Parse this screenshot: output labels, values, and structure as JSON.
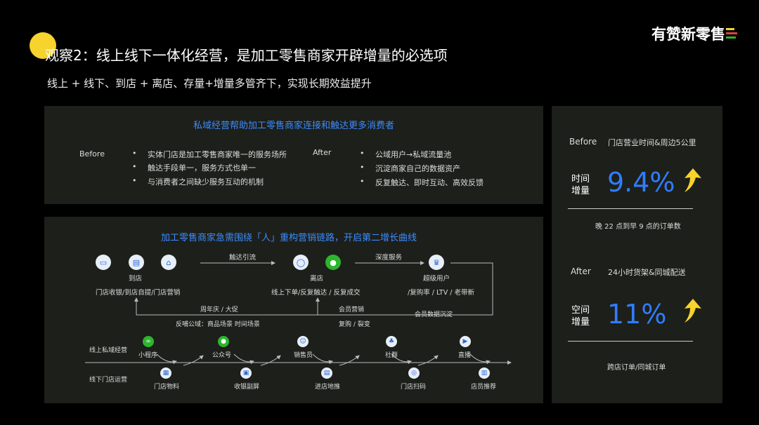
{
  "header": {
    "title": "观察2：线上线下一体化经营，是加工零售商家开辟增量的必选项",
    "subtitle": "线上 + 线下、到店 + 离店、存量+增量多管齐下，实现长期效益提升",
    "logo": "有赞新零售"
  },
  "panel1": {
    "title": "私域经营帮助加工零售商家连接和触达更多消费者",
    "before_label": "Before",
    "before_items": [
      "实体门店是加工零售商家唯一的服务场所",
      "触达手段单一，服务方式也单一",
      "与消费者之间缺少服务互动的机制"
    ],
    "after_label": "After",
    "after_items": [
      "公域用户→私域流量池",
      "沉淀商家自己的数据资产",
      "反复触达、即时互动、高效反馈"
    ]
  },
  "panel2": {
    "title": "加工零售商家急需围绕「人」重构营销链路，开启第二增长曲线",
    "store_label": "到店",
    "store_desc": "门店收银/到店自提/门店营销",
    "reach_label": "触达引流",
    "offline_label": "离店",
    "offline_desc": "线上下单/反复触达 / 反复成交",
    "deep_label": "深度服务",
    "super_label": "超级用户",
    "super_desc": "/复购率 / LTV / 老带新",
    "anniv_label": "周年庆 / 大促",
    "member_mkt_label": "会员营销",
    "member_data_label": "会员数据沉淀",
    "feedback_label": "反哺公域：商品场景 时间场景",
    "repurchase_label": "复购 / 裂变",
    "online_row_label": "线上私域经营",
    "offline_row_label": "线下门店运营",
    "online_items": [
      "小程序",
      "公众号",
      "销售员",
      "社群",
      "直播"
    ],
    "offline_items": [
      "门店物料",
      "收银副屏",
      "进店地推",
      "门店扫码",
      "店员推荐"
    ]
  },
  "panel3": {
    "before_label": "Before",
    "before_desc": "门店营业时间&周边5公里",
    "stat1_label_l1": "时间",
    "stat1_label_l2": "增量",
    "stat1_value": "9.4%",
    "stat1_note": "晚 22 点到早 9 点的订单数",
    "after_label": "After",
    "after_desc": "24小时货架&同城配送",
    "stat2_label_l1": "空间",
    "stat2_label_l2": "增量",
    "stat2_value": "11%",
    "stat2_note": "跨店订单/同城订单"
  },
  "colors": {
    "accent_blue": "#2f7dff",
    "accent_yellow": "#f6d32d",
    "panel_bg": "#1d1f1a"
  }
}
